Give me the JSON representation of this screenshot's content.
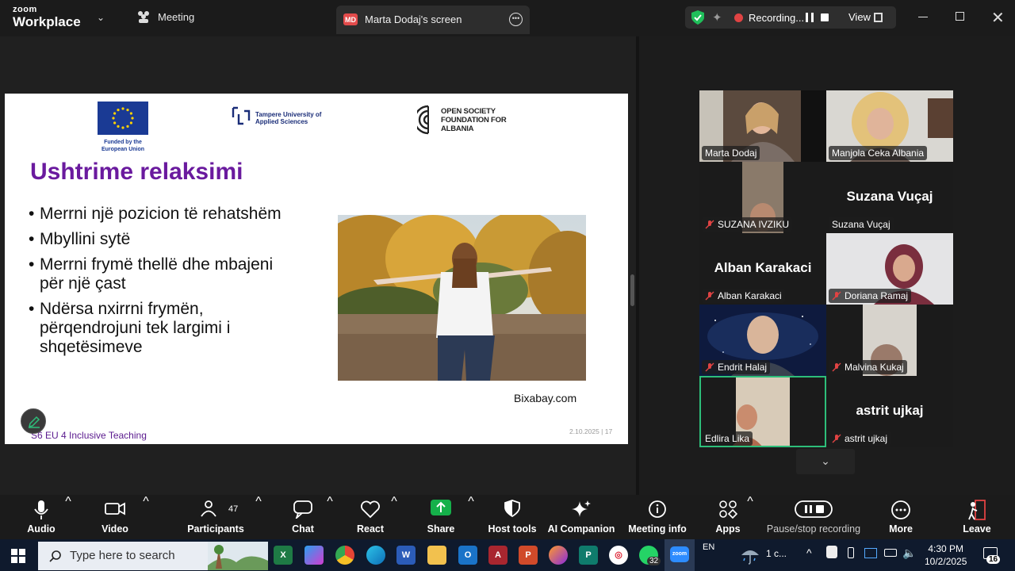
{
  "app": {
    "brand_top": "zoom",
    "brand_bottom": "Workplace",
    "meeting_label": "Meeting"
  },
  "screen_tab": {
    "initials": "MD",
    "label": "Marta Dodaj's screen"
  },
  "recording": {
    "label": "Recording...",
    "view_label": "View"
  },
  "slide": {
    "eu_caption": "Funded by the European Union",
    "tampere": "Tampere University of Applied Sciences",
    "osf": "OPEN SOCIETY FOUNDATION FOR ALBANIA",
    "title": "Ushtrime relaksimi",
    "bullets": [
      "Merrni një pozicion të rehatshëm",
      "Mbyllini sytë",
      "Merrni frymë thellë dhe mbajeni për një çast",
      "Ndërsa nxirrni frymën, përqendrojuni tek largimi i shqetësimeve"
    ],
    "credit": "Bixabay.com",
    "footer": "S6 EU 4 Inclusive Teaching",
    "date_page": "2.10.2025  |  17"
  },
  "participants": [
    {
      "name": "Marta Dodaj",
      "muted": false
    },
    {
      "name": "Manjola Ceka Albania",
      "muted": false
    },
    {
      "name": "SUZANA IVZIKU",
      "muted": true
    },
    {
      "name": "Suzana Vuçaj",
      "muted": false,
      "big": "Suzana Vuçaj"
    },
    {
      "name": "Alban Karakaci",
      "muted": true,
      "big": "Alban Karakaci"
    },
    {
      "name": "Doriana Ramaj",
      "muted": true
    },
    {
      "name": "Endrit Halaj",
      "muted": true
    },
    {
      "name": "Malvina Kukaj",
      "muted": true
    },
    {
      "name": "Edlira Lika",
      "muted": false
    },
    {
      "name": "astrit ujkaj",
      "muted": true,
      "big": "astrit ujkaj"
    }
  ],
  "toolbar": {
    "audio": "Audio",
    "video": "Video",
    "participants": "Participants",
    "participants_count": "47",
    "chat": "Chat",
    "react": "React",
    "share": "Share",
    "host_tools": "Host tools",
    "ai": "AI Companion",
    "info": "Meeting info",
    "apps": "Apps",
    "pause_rec": "Pause/stop recording",
    "more": "More",
    "leave": "Leave"
  },
  "taskbar": {
    "search_placeholder": "Type here to search",
    "whatsapp_badge": "32",
    "lang": "EN",
    "weather": "1 c...",
    "time": "4:30 PM",
    "date": "10/2/2025",
    "notifications": "16"
  },
  "colors": {
    "accent_green": "#2dbe7a",
    "record_red": "#e04343",
    "slide_title": "#6a1a9e"
  }
}
